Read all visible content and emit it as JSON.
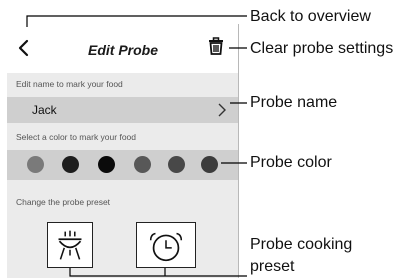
{
  "screen": {
    "title": "Edit Probe",
    "name_section_label": "Edit name to mark your food",
    "name_value": "Jack",
    "color_section_label": "Select a color to mark your food",
    "preset_section_label": "Change the probe preset",
    "swatches": [
      {
        "color": "#7a7a7a"
      },
      {
        "color": "#1e1e1e"
      },
      {
        "color": "#0b0b0b"
      },
      {
        "color": "#585858"
      },
      {
        "color": "#484848"
      },
      {
        "color": "#3c3c3c"
      }
    ],
    "presets": [
      {
        "icon": "grill-icon"
      },
      {
        "icon": "alarm-clock-icon"
      }
    ]
  },
  "callouts": {
    "back": "Back to overview",
    "clear": "Clear probe settings",
    "name": "Probe name",
    "color": "Probe color",
    "preset_line1": "Probe cooking",
    "preset_line2": "preset"
  }
}
